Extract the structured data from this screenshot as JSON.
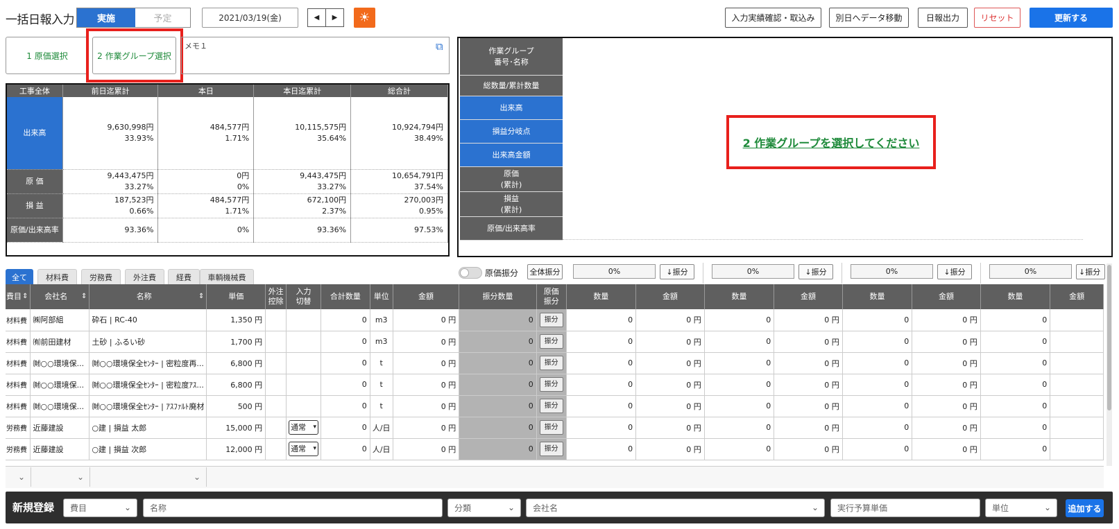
{
  "header": {
    "title": "一括日報入力",
    "mode_on": "実施",
    "mode_off": "予定",
    "date": "2021/03/19(金)",
    "prev": "◀",
    "next": "▶",
    "sun": "☀",
    "buttons": {
      "confirm_import": "入力実績確認・取込み",
      "move_data": "別日へデータ移動",
      "export": "日報出力",
      "reset": "リセット",
      "update": "更新する"
    }
  },
  "steps": {
    "step1": "1 原価選択",
    "step2": "2 作業グループ選択",
    "memo_label": "メモ１",
    "external_link_icon": "⧉"
  },
  "summary": {
    "headers": [
      "工事全体",
      "前日迄累計",
      "本日",
      "本日迄累計",
      "総合計"
    ],
    "rows": [
      {
        "label": "出来高",
        "cells": [
          [
            "9,630,998円",
            "33.93%"
          ],
          [
            "484,577円",
            "1.71%"
          ],
          [
            "10,115,575円",
            "35.64%"
          ],
          [
            "10,924,794円",
            "38.49%"
          ]
        ]
      },
      {
        "label": "原 価",
        "cells": [
          [
            "9,443,475円",
            "33.27%"
          ],
          [
            "0円",
            "0%"
          ],
          [
            "9,443,475円",
            "33.27%"
          ],
          [
            "10,654,791円",
            "37.54%"
          ]
        ]
      },
      {
        "label": "損 益",
        "cells": [
          [
            "187,523円",
            "0.66%"
          ],
          [
            "484,577円",
            "1.71%"
          ],
          [
            "672,100円",
            "2.37%"
          ],
          [
            "270,003円",
            "0.95%"
          ]
        ]
      },
      {
        "label": "原価/出来高率",
        "cells": [
          [
            "93.36%"
          ],
          [
            "0%"
          ],
          [
            "93.36%"
          ],
          [
            "97.53%"
          ]
        ]
      }
    ]
  },
  "right_panel": {
    "rows": [
      {
        "label": "作業グループ\n番号･名称",
        "type": "g"
      },
      {
        "label": "総数量/累計数量",
        "type": "g"
      },
      {
        "label": "出来高",
        "type": "b"
      },
      {
        "label": "損益分岐点",
        "type": "b"
      },
      {
        "label": "出来高金額",
        "type": "b"
      },
      {
        "label": "原価\n(累計)",
        "type": "g"
      },
      {
        "label": "損益\n(累計)",
        "type": "g"
      },
      {
        "label": "原価/出来高率",
        "type": "g"
      }
    ],
    "message": "2 作業グループを選択してください"
  },
  "tabs": [
    "全て",
    "材料費",
    "労務費",
    "外注費",
    "経費",
    "車輌機械費"
  ],
  "toolbar": {
    "toggle_label": "原価振分",
    "all_distribute": "全体振分",
    "pct": "0%",
    "distribute": "↓振分"
  },
  "grid": {
    "headers": [
      "費目",
      "会社名",
      "名称",
      "単価",
      "外注\n控除",
      "入力\n切替",
      "合計数量",
      "単位",
      "金額",
      "振分数量",
      "原価\n振分",
      "数量",
      "金額",
      "数量",
      "金額",
      "数量",
      "金額",
      "数量",
      "金額"
    ],
    "sort_icon": "⇕",
    "distribute_btn": "振分",
    "rows": [
      {
        "cat": "材料費",
        "company": "㈱阿部組",
        "name": "砕石 | RC-40",
        "price": "1,350 円",
        "switch": "",
        "qty": "0",
        "unit": "m3",
        "amount": "0 円",
        "dqty": "0",
        "cols": [
          "0",
          "0 円",
          "0",
          "0 円",
          "0",
          "0 円",
          "0",
          ""
        ]
      },
      {
        "cat": "材料費",
        "company": "㈲前田建材",
        "name": "土砂 | ふるい砂",
        "price": "1,700 円",
        "switch": "",
        "qty": "0",
        "unit": "m3",
        "amount": "0 円",
        "dqty": "0",
        "cols": [
          "0",
          "0 円",
          "0",
          "0 円",
          "0",
          "0 円",
          "0",
          ""
        ]
      },
      {
        "cat": "材料費",
        "company": "㈶○○環境保...",
        "name": "㈶○○環境保全ｾﾝﾀｰ | 密粒度再...",
        "price": "6,800 円",
        "switch": "",
        "qty": "0",
        "unit": "t",
        "amount": "0 円",
        "dqty": "0",
        "cols": [
          "0",
          "0 円",
          "0",
          "0 円",
          "0",
          "0 円",
          "0",
          ""
        ]
      },
      {
        "cat": "材料費",
        "company": "㈶○○環境保...",
        "name": "㈶○○環境保全ｾﾝﾀｰ | 密粒度ｱｽ...",
        "price": "6,800 円",
        "switch": "",
        "qty": "0",
        "unit": "t",
        "amount": "0 円",
        "dqty": "0",
        "cols": [
          "0",
          "0 円",
          "0",
          "0 円",
          "0",
          "0 円",
          "0",
          ""
        ]
      },
      {
        "cat": "材料費",
        "company": "㈶○○環境保...",
        "name": "㈶○○環境保全ｾﾝﾀｰ | ｱｽﾌｧﾙﾄ廃材",
        "price": "500 円",
        "switch": "",
        "qty": "0",
        "unit": "t",
        "amount": "0 円",
        "dqty": "0",
        "cols": [
          "0",
          "0 円",
          "0",
          "0 円",
          "0",
          "0 円",
          "0",
          ""
        ]
      },
      {
        "cat": "労務費",
        "company": "近藤建設",
        "name": "○建 | 損益 太郎",
        "price": "15,000 円",
        "switch": "通常",
        "qty": "0",
        "unit": "人/日",
        "amount": "0 円",
        "dqty": "0",
        "cols": [
          "0",
          "0 円",
          "0",
          "0 円",
          "0",
          "0 円",
          "0",
          ""
        ]
      },
      {
        "cat": "労務費",
        "company": "近藤建設",
        "name": "○建 | 損益 次郎",
        "price": "12,000 円",
        "switch": "通常",
        "qty": "0",
        "unit": "人/日",
        "amount": "0 円",
        "dqty": "0",
        "cols": [
          "0",
          "0 円",
          "0",
          "0 円",
          "0",
          "0 円",
          "0",
          ""
        ]
      }
    ]
  },
  "footer": {
    "title": "新規登録",
    "category_placeholder": "費目",
    "name_placeholder": "名称",
    "class_placeholder": "分類",
    "company_placeholder": "会社名",
    "price_placeholder": "実行予算単価",
    "unit_placeholder": "単位",
    "add": "追加する"
  },
  "chevron": "⌄",
  "colors": {
    "primary": "#2b72d0",
    "accent_orange": "#f26a1b",
    "green_text": "#1e8a3a",
    "highlight_red": "#e8201c",
    "dark_header": "#5f5f5f"
  }
}
